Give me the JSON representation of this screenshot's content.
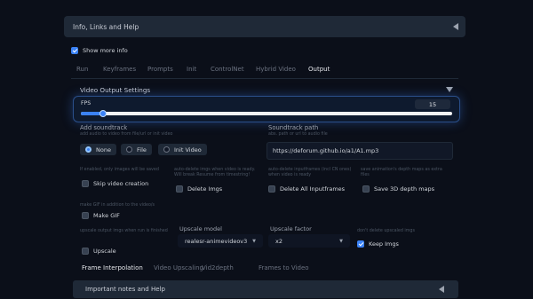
{
  "top_accordion": {
    "title": "Info, Links and Help"
  },
  "show_more_info": {
    "label": "Show more info",
    "checked": true
  },
  "tabs": [
    {
      "label": "Run",
      "active": false
    },
    {
      "label": "Keyframes",
      "active": false
    },
    {
      "label": "Prompts",
      "active": false
    },
    {
      "label": "Init",
      "active": false
    },
    {
      "label": "ControlNet",
      "active": false
    },
    {
      "label": "Hybrid Video",
      "active": false
    },
    {
      "label": "Output",
      "active": true
    }
  ],
  "video_output": {
    "title": "Video Output Settings",
    "fps": {
      "label": "FPS",
      "value": "15",
      "fraction": 0.06
    },
    "add_soundtrack": {
      "label": "Add soundtrack",
      "hint": "add audio to video from file/url or init video",
      "options": [
        "None",
        "File",
        "Init Video"
      ],
      "selected": "None"
    },
    "soundtrack_path": {
      "label": "Soundtrack path",
      "hint": "abs. path or url to audio file",
      "value": "https://deforum.github.io/a1/A1.mp3"
    },
    "skip_video": {
      "hint": "If enabled, only images will be saved",
      "label": "Skip video creation",
      "checked": false
    },
    "delete_imgs": {
      "hint": "auto-delete imgs when video is ready. Will break Resume from timestring!",
      "label": "Delete Imgs",
      "checked": false
    },
    "delete_inputframes": {
      "hint": "auto-delete inputframes (incl CN ones) when video is ready",
      "label": "Delete All Inputframes",
      "checked": false
    },
    "save_depth": {
      "hint": "save animation's depth maps as extra files",
      "label": "Save 3D depth maps",
      "checked": false
    },
    "make_gif": {
      "hint": "make GIF in addition to the video/s",
      "label": "Make GIF",
      "checked": false
    },
    "upscale": {
      "hint": "upscale output imgs when run is finished",
      "label": "Upscale",
      "checked": false
    },
    "upscale_model": {
      "label": "Upscale model",
      "value": "realesr-animevideov3"
    },
    "upscale_factor": {
      "label": "Upscale factor",
      "value": "x2"
    },
    "keep_imgs": {
      "hint": "don't delete upscaled imgs",
      "label": "Keep Imgs",
      "checked": true
    }
  },
  "sub_tabs": [
    {
      "label": "Frame Interpolation",
      "active": true
    },
    {
      "label": "Video Upscaling",
      "active": false
    },
    {
      "label": "Vid2depth",
      "active": false
    },
    {
      "label": "Frames to Video",
      "active": false
    }
  ],
  "bottom_accordion": {
    "title": "Important notes and Help"
  },
  "colors": {
    "accent": "#3b82f6",
    "background": "#0b0f19",
    "panel": "#1f2937"
  },
  "icons": [
    "triangle-left-icon",
    "triangle-down-icon",
    "chevron-down-icon",
    "checkmark-icon"
  ]
}
